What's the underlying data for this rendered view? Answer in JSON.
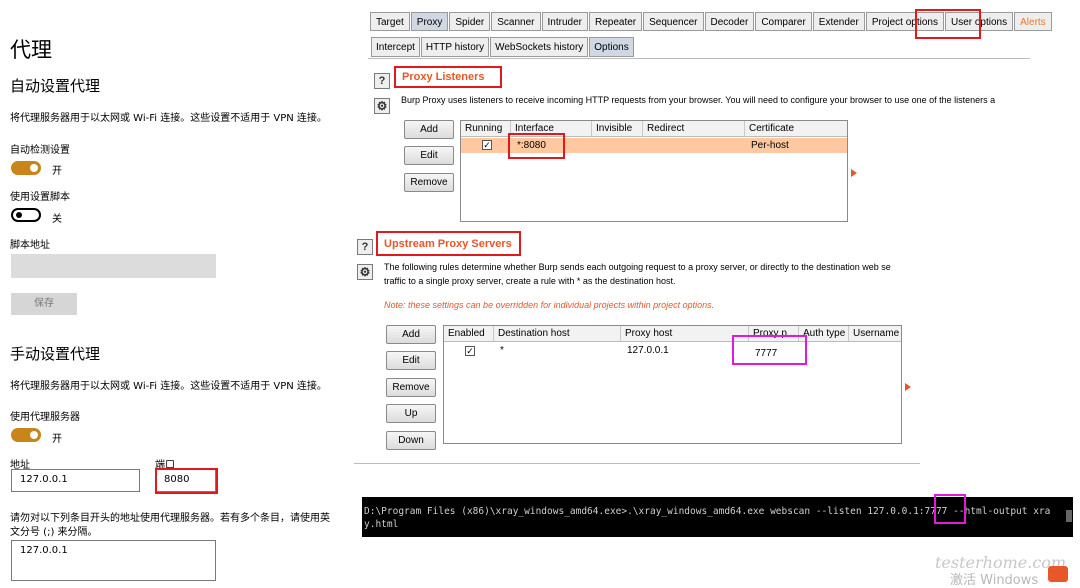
{
  "windows": {
    "title": "代理",
    "auto_section": {
      "heading": "自动设置代理",
      "description": "将代理服务器用于以太网或 Wi-Fi 连接。这些设置不适用于 VPN 连接。",
      "detect_label": "自动检测设置",
      "detect_state": "开",
      "script_label": "使用设置脚本",
      "script_state": "关",
      "address_label": "脚本地址",
      "save_button": "保存"
    },
    "manual_section": {
      "heading": "手动设置代理",
      "description": "将代理服务器用于以太网或 Wi-Fi 连接。这些设置不适用于 VPN 连接。",
      "use_proxy_label": "使用代理服务器",
      "use_proxy_state": "开",
      "address_label": "地址",
      "address_value": "127.0.0.1",
      "port_label": "端口",
      "port_value": "8080",
      "exceptions_desc_line1": "请勿对以下列条目开头的地址使用代理服务器。若有多个条目，请使用英",
      "exceptions_desc_line2": "文分号 (;) 来分隔。",
      "exceptions_value": "127.0.0.1"
    }
  },
  "burp": {
    "tabs": [
      "Target",
      "Proxy",
      "Spider",
      "Scanner",
      "Intruder",
      "Repeater",
      "Sequencer",
      "Decoder",
      "Comparer",
      "Extender",
      "Project options",
      "User options",
      "Alerts"
    ],
    "active_tab": "Proxy",
    "subtabs": [
      "Intercept",
      "HTTP history",
      "WebSockets history",
      "Options"
    ],
    "active_subtab": "Options",
    "proxy_listeners": {
      "title": "Proxy Listeners",
      "description": "Burp Proxy uses listeners to receive incoming HTTP requests from your browser. You will need to configure your browser to use one of the listeners a",
      "buttons": [
        "Add",
        "Edit",
        "Remove"
      ],
      "columns": [
        "Running",
        "Interface",
        "Invisible",
        "Redirect",
        "Certificate"
      ],
      "row": {
        "running": "✓",
        "interface": "*:8080",
        "invisible": "",
        "redirect": "",
        "certificate": "Per-host"
      }
    },
    "upstream": {
      "title": "Upstream Proxy Servers",
      "description_line1": "The following rules determine whether Burp sends each outgoing request to a proxy server, or directly to the destination web se",
      "description_line2": "traffic to a single proxy server, create a rule with * as the destination host.",
      "note": "Note: these settings can be overridden for individual projects within project options.",
      "buttons": [
        "Add",
        "Edit",
        "Remove",
        "Up",
        "Down"
      ],
      "columns": [
        "Enabled",
        "Destination host",
        "Proxy host",
        "Proxy p...",
        "Auth type",
        "Username"
      ],
      "row": {
        "enabled": "✓",
        "destination": "*",
        "proxy_host": "127.0.0.1",
        "proxy_port": "7777",
        "auth": "",
        "username": ""
      }
    },
    "icons": {
      "help": "?",
      "gear": "⚙"
    }
  },
  "terminal": {
    "line1_prefix": "D:\\Program Files (x86)\\xray_windows_amd64.exe>.\\xray_windows_amd64.exe webscan --listen 127.0.0.1:",
    "port": "7777",
    "line1_suffix": " --html-output xra",
    "line2": "y.html"
  },
  "watermark": {
    "site": "testerhome.com",
    "activate": "激活 Windows"
  },
  "colors": {
    "toggle_on": "#c8861a",
    "highlight_red": "#e0191d",
    "highlight_magenta": "#e01ad8",
    "burp_orange": "#e8572a",
    "selected_row": "#ffc8a0"
  }
}
